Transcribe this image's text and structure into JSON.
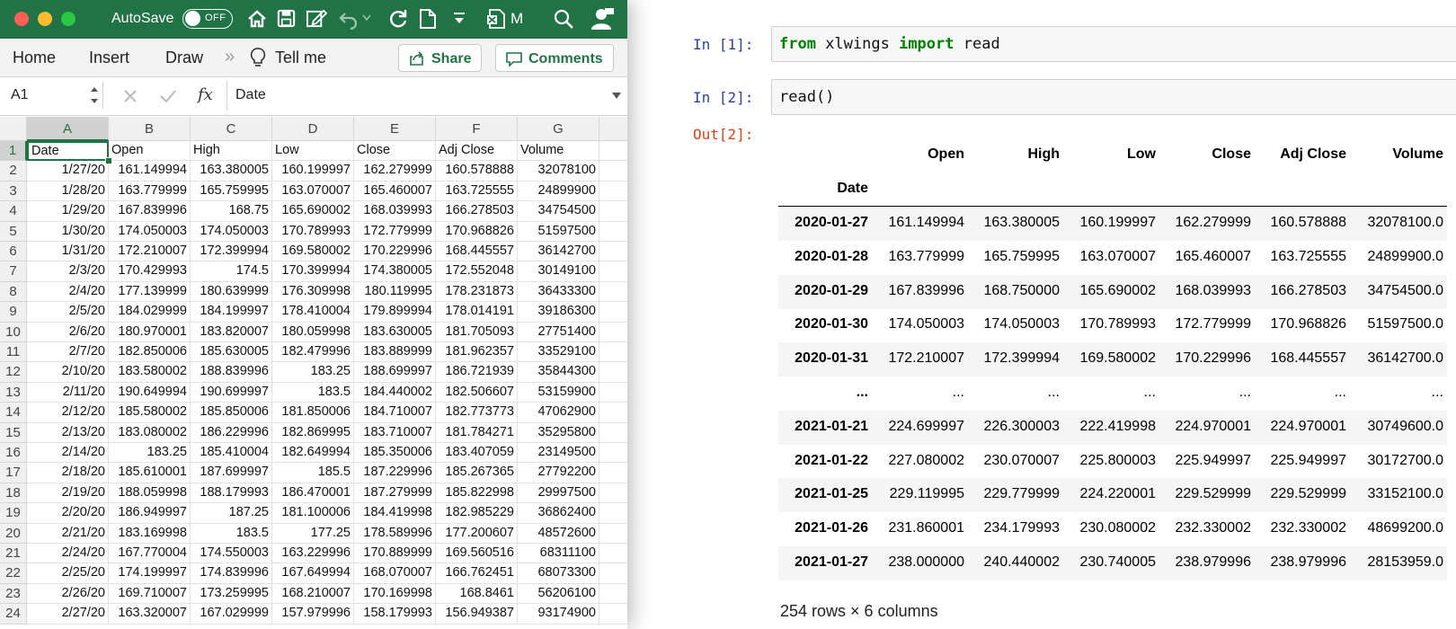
{
  "excel": {
    "autosave_label": "AutoSave",
    "toggle_label": "OFF",
    "doc_title_fragment": "M",
    "ribbon_tabs": [
      "Home",
      "Insert",
      "Draw"
    ],
    "more_glyph": "»",
    "tell_me": "Tell me",
    "share_label": "Share",
    "comments_label": "Comments",
    "name_box": "A1",
    "fx_label": "fx",
    "formula_value": "Date",
    "column_headers": [
      "A",
      "B",
      "C",
      "D",
      "E",
      "F",
      "G"
    ],
    "row_numbers": [
      "1",
      "2",
      "3",
      "4",
      "5",
      "6",
      "7",
      "8",
      "9",
      "10",
      "11",
      "12",
      "13",
      "14",
      "15",
      "16",
      "17",
      "18",
      "19",
      "20",
      "21",
      "22",
      "23",
      "24"
    ],
    "rows": [
      [
        "Date",
        "Open",
        "High",
        "Low",
        "Close",
        "Adj Close",
        "Volume"
      ],
      [
        "1/27/20",
        "161.149994",
        "163.380005",
        "160.199997",
        "162.279999",
        "160.578888",
        "32078100"
      ],
      [
        "1/28/20",
        "163.779999",
        "165.759995",
        "163.070007",
        "165.460007",
        "163.725555",
        "24899900"
      ],
      [
        "1/29/20",
        "167.839996",
        "168.75",
        "165.690002",
        "168.039993",
        "166.278503",
        "34754500"
      ],
      [
        "1/30/20",
        "174.050003",
        "174.050003",
        "170.789993",
        "172.779999",
        "170.968826",
        "51597500"
      ],
      [
        "1/31/20",
        "172.210007",
        "172.399994",
        "169.580002",
        "170.229996",
        "168.445557",
        "36142700"
      ],
      [
        "2/3/20",
        "170.429993",
        "174.5",
        "170.399994",
        "174.380005",
        "172.552048",
        "30149100"
      ],
      [
        "2/4/20",
        "177.139999",
        "180.639999",
        "176.309998",
        "180.119995",
        "178.231873",
        "36433300"
      ],
      [
        "2/5/20",
        "184.029999",
        "184.199997",
        "178.410004",
        "179.899994",
        "178.014191",
        "39186300"
      ],
      [
        "2/6/20",
        "180.970001",
        "183.820007",
        "180.059998",
        "183.630005",
        "181.705093",
        "27751400"
      ],
      [
        "2/7/20",
        "182.850006",
        "185.630005",
        "182.479996",
        "183.889999",
        "181.962357",
        "33529100"
      ],
      [
        "2/10/20",
        "183.580002",
        "188.839996",
        "183.25",
        "188.699997",
        "186.721939",
        "35844300"
      ],
      [
        "2/11/20",
        "190.649994",
        "190.699997",
        "183.5",
        "184.440002",
        "182.506607",
        "53159900"
      ],
      [
        "2/12/20",
        "185.580002",
        "185.850006",
        "181.850006",
        "184.710007",
        "182.773773",
        "47062900"
      ],
      [
        "2/13/20",
        "183.080002",
        "186.229996",
        "182.869995",
        "183.710007",
        "181.784271",
        "35295800"
      ],
      [
        "2/14/20",
        "183.25",
        "185.410004",
        "182.649994",
        "185.350006",
        "183.407059",
        "23149500"
      ],
      [
        "2/18/20",
        "185.610001",
        "187.699997",
        "185.5",
        "187.229996",
        "185.267365",
        "27792200"
      ],
      [
        "2/19/20",
        "188.059998",
        "188.179993",
        "186.470001",
        "187.279999",
        "185.822998",
        "29997500"
      ],
      [
        "2/20/20",
        "186.949997",
        "187.25",
        "181.100006",
        "184.419998",
        "182.985229",
        "36862400"
      ],
      [
        "2/21/20",
        "183.169998",
        "183.5",
        "177.25",
        "178.589996",
        "177.200607",
        "48572600"
      ],
      [
        "2/24/20",
        "167.770004",
        "174.550003",
        "163.229996",
        "170.889999",
        "169.560516",
        "68311100"
      ],
      [
        "2/25/20",
        "174.199997",
        "174.839996",
        "167.649994",
        "168.070007",
        "166.762451",
        "68073300"
      ],
      [
        "2/26/20",
        "169.710007",
        "173.259995",
        "168.210007",
        "170.169998",
        "168.8461",
        "56206100"
      ],
      [
        "2/27/20",
        "163.320007",
        "167.029999",
        "157.979996",
        "158.179993",
        "156.949387",
        "93174900"
      ]
    ]
  },
  "notebook": {
    "in1_prompt": "In [1]:",
    "in1_code": {
      "kw1": "from",
      "mod": " xlwings ",
      "kw2": "import",
      "name": " read"
    },
    "in2_prompt": "In [2]:",
    "in2_code": "read()",
    "out2_prompt": "Out[2]:",
    "df_columns": [
      "Open",
      "High",
      "Low",
      "Close",
      "Adj Close",
      "Volume"
    ],
    "df_index_name": "Date",
    "df_rows": [
      [
        "2020-01-27",
        "161.149994",
        "163.380005",
        "160.199997",
        "162.279999",
        "160.578888",
        "32078100.0"
      ],
      [
        "2020-01-28",
        "163.779999",
        "165.759995",
        "163.070007",
        "165.460007",
        "163.725555",
        "24899900.0"
      ],
      [
        "2020-01-29",
        "167.839996",
        "168.750000",
        "165.690002",
        "168.039993",
        "166.278503",
        "34754500.0"
      ],
      [
        "2020-01-30",
        "174.050003",
        "174.050003",
        "170.789993",
        "172.779999",
        "170.968826",
        "51597500.0"
      ],
      [
        "2020-01-31",
        "172.210007",
        "172.399994",
        "169.580002",
        "170.229996",
        "168.445557",
        "36142700.0"
      ],
      [
        "...",
        "...",
        "...",
        "...",
        "...",
        "...",
        "..."
      ],
      [
        "2021-01-21",
        "224.699997",
        "226.300003",
        "222.419998",
        "224.970001",
        "224.970001",
        "30749600.0"
      ],
      [
        "2021-01-22",
        "227.080002",
        "230.070007",
        "225.800003",
        "225.949997",
        "225.949997",
        "30172700.0"
      ],
      [
        "2021-01-25",
        "229.119995",
        "229.779999",
        "224.220001",
        "229.529999",
        "229.529999",
        "33152100.0"
      ],
      [
        "2021-01-26",
        "231.860001",
        "234.179993",
        "230.080002",
        "232.330002",
        "232.330002",
        "48699200.0"
      ],
      [
        "2021-01-27",
        "238.000000",
        "240.440002",
        "230.740005",
        "238.979996",
        "238.979996",
        "28153959.0"
      ]
    ],
    "df_shape": "254 rows × 6 columns"
  },
  "colors": {
    "excel_green": "#217346",
    "prompt_in": "#303f9f",
    "prompt_out": "#d84315",
    "keyword": "#008000"
  }
}
